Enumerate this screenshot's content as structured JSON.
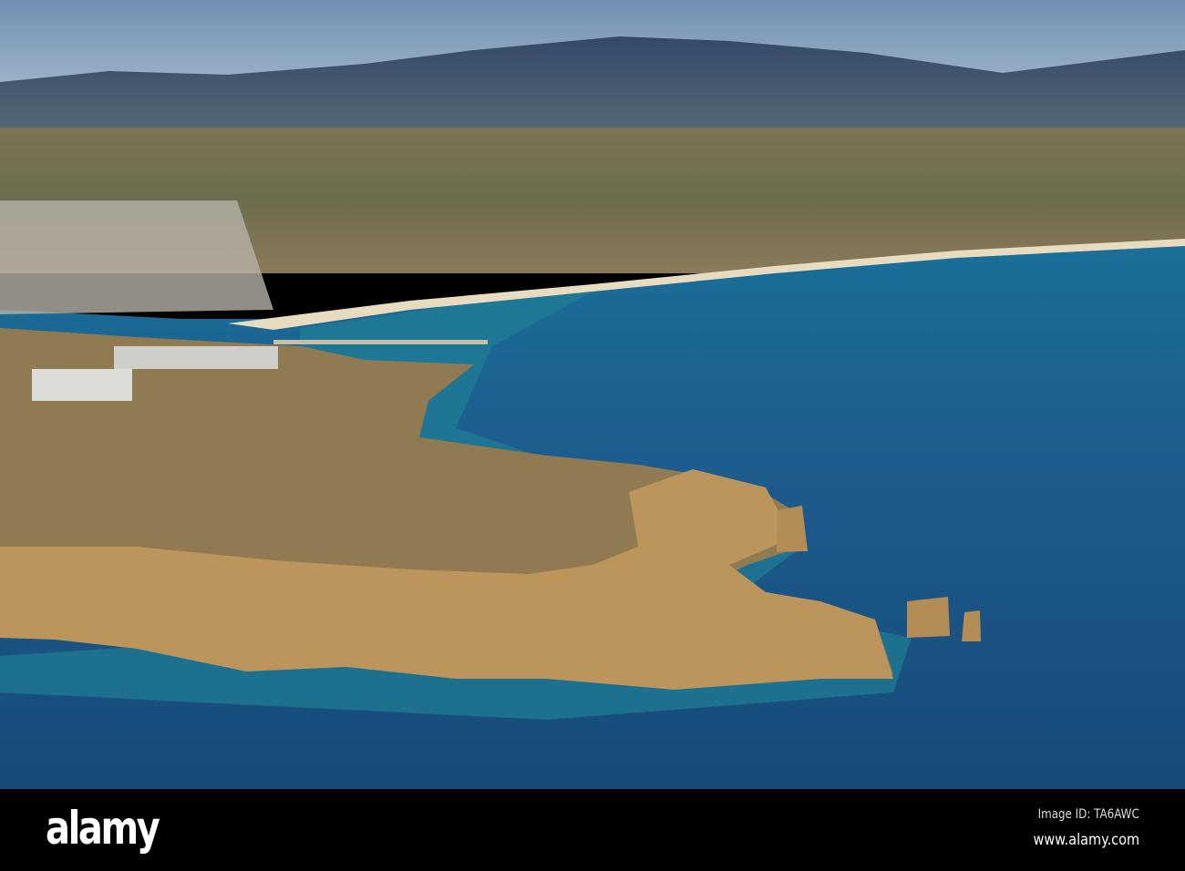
{
  "photo": {
    "subject": "Aerial view of coastline with cliffs, beach, town and mountains",
    "colors": {
      "sky": "#8aa6bf",
      "mountains": "#3d5676",
      "sea": "#1d5585",
      "shallow": "#1f8a9a",
      "cliffs": "#b8935a",
      "land": "#8a7556"
    }
  },
  "footer": {
    "logo": "alamy",
    "image_id": "Image ID: TA6AWC",
    "url": "www.alamy.com"
  }
}
